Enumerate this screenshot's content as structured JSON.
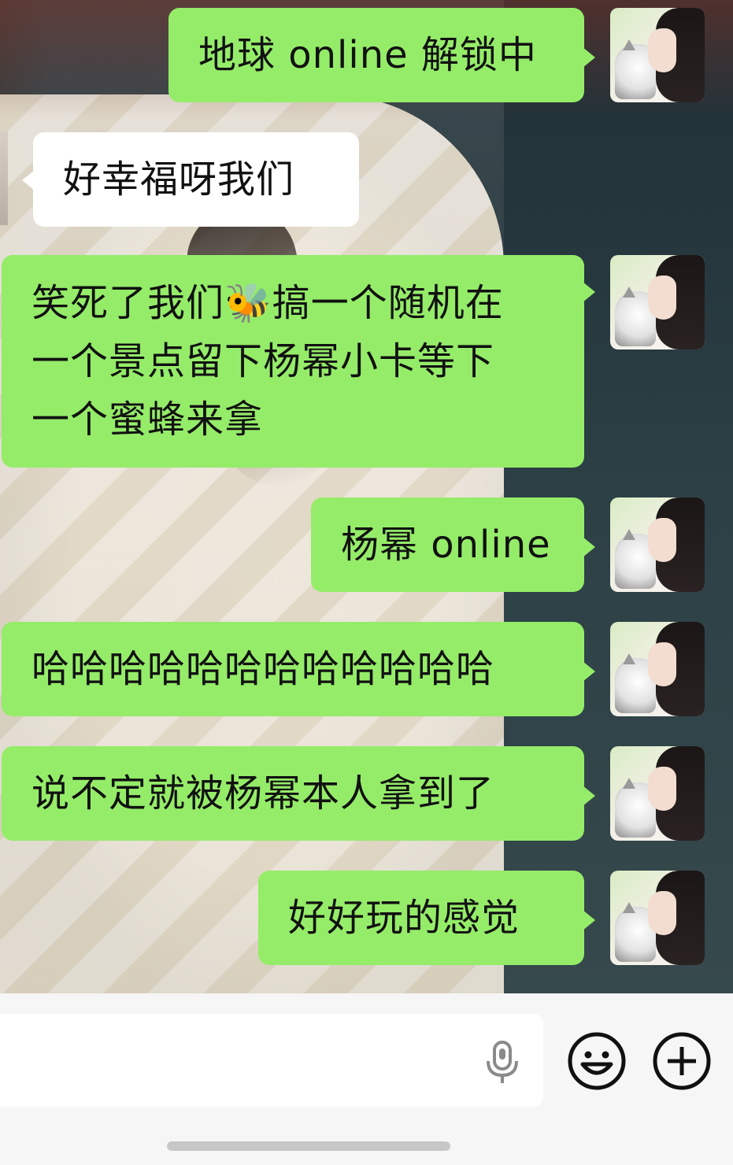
{
  "chat": {
    "messages": [
      {
        "side": "me",
        "text": "地球 online 解锁中"
      },
      {
        "side": "them",
        "text": "好幸福呀我们"
      },
      {
        "side": "me",
        "lines": [
          "笑死了我们🐝搞一个随机在",
          "一个景点留下杨幂小卡等下",
          "一个蜜蜂来拿"
        ]
      },
      {
        "side": "me",
        "text": "杨幂 online"
      },
      {
        "side": "me",
        "text": "哈哈哈哈哈哈哈哈哈哈哈哈"
      },
      {
        "side": "me",
        "text": "说不定就被杨幂本人拿到了"
      },
      {
        "side": "me",
        "text": "好好玩的感觉"
      }
    ]
  },
  "input_bar": {
    "voice_icon": "microphone-icon",
    "emoji_icon": "smiley-face-icon",
    "more_icon": "plus-circle-icon"
  },
  "colors": {
    "my_bubble": "#95ec69",
    "their_bubble": "#ffffff",
    "input_bar_bg": "#f6f6f6"
  }
}
